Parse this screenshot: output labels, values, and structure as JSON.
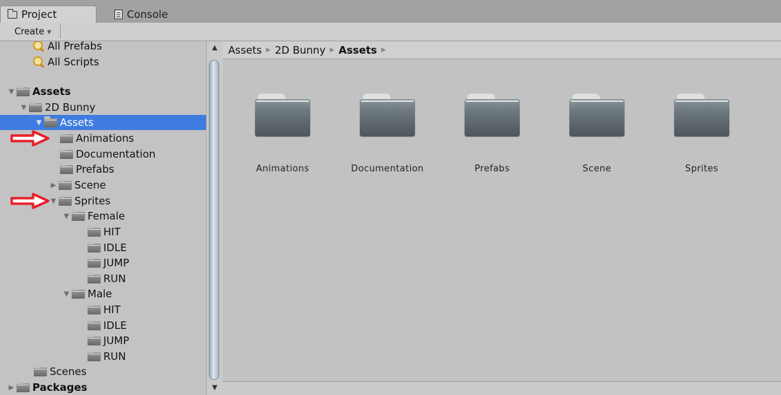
{
  "tabs": [
    {
      "label": "Project",
      "icon": "folder-icon"
    },
    {
      "label": "Console",
      "icon": "console-icon"
    }
  ],
  "toolbar": {
    "create_label": "Create"
  },
  "tree": {
    "items": [
      {
        "label": "All Prefabs",
        "icon": "search-icon",
        "bold": false
      },
      {
        "label": "All Scripts",
        "icon": "search-icon",
        "bold": false
      },
      {
        "label": "Assets",
        "icon": "folder-icon",
        "bold": true,
        "expanded": true
      },
      {
        "label": "2D Bunny",
        "icon": "folder-icon",
        "expanded": true
      },
      {
        "label": "Assets",
        "icon": "folder-icon",
        "expanded": true,
        "selected": true
      },
      {
        "label": "Animations",
        "icon": "folder-icon"
      },
      {
        "label": "Documentation",
        "icon": "folder-icon"
      },
      {
        "label": "Prefabs",
        "icon": "folder-icon"
      },
      {
        "label": "Scene",
        "icon": "folder-icon",
        "expanded": false
      },
      {
        "label": "Sprites",
        "icon": "folder-icon",
        "expanded": true
      },
      {
        "label": "Female",
        "icon": "folder-icon",
        "expanded": true
      },
      {
        "label": "HIT",
        "icon": "folder-icon"
      },
      {
        "label": "IDLE",
        "icon": "folder-icon"
      },
      {
        "label": "JUMP",
        "icon": "folder-icon"
      },
      {
        "label": "RUN",
        "icon": "folder-icon"
      },
      {
        "label": "Male",
        "icon": "folder-icon",
        "expanded": true
      },
      {
        "label": "HIT",
        "icon": "folder-icon"
      },
      {
        "label": "IDLE",
        "icon": "folder-icon"
      },
      {
        "label": "JUMP",
        "icon": "folder-icon"
      },
      {
        "label": "RUN",
        "icon": "folder-icon"
      },
      {
        "label": "Scenes",
        "icon": "folder-icon"
      },
      {
        "label": "Packages",
        "icon": "folder-icon",
        "bold": true,
        "expanded": false
      }
    ]
  },
  "breadcrumb": [
    "Assets",
    "2D Bunny",
    "Assets"
  ],
  "grid": {
    "folders": [
      "Animations",
      "Documentation",
      "Prefabs",
      "Scene",
      "Sprites"
    ]
  },
  "annotation_color": "#e8202a",
  "selection_color": "#3e7ce0"
}
